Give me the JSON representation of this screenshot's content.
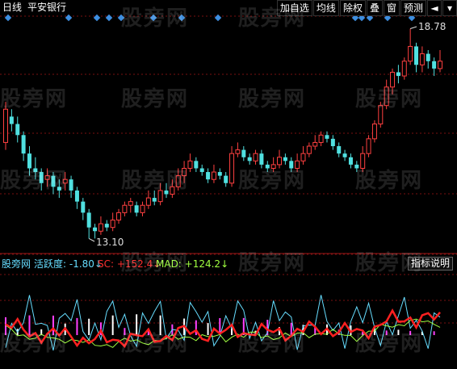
{
  "header": {
    "period": "日线",
    "stock_name": "平安银行"
  },
  "toolbar": {
    "buttons": [
      "加自选",
      "均线",
      "除权",
      "叠",
      "窗",
      "预测"
    ],
    "nav_left_icon": "arrow-left-icon",
    "nav_down_icon": "chevron-down-icon"
  },
  "price_labels": {
    "high": "18.78",
    "low": "13.10"
  },
  "indicator": {
    "name": "股旁网",
    "active_label": "活跃度: -1.80↓",
    "sc_label": "SC: +152.4↓",
    "mad_label": "MAD: +124.2↓",
    "help_button": "指标说明"
  },
  "watermark": "股旁网",
  "colors": {
    "background": "#000000",
    "up": "#ff4040",
    "down": "#50e0e0",
    "grid": "#7a1010",
    "marker": "#3d8ee0",
    "active": "#66ddff",
    "sc": "#ff2020",
    "mad": "#a0ff40",
    "bar_magenta": "#ff40ff"
  },
  "chart_data": {
    "type": "candlestick",
    "high": 18.78,
    "low": 13.1,
    "candles": [
      [
        15.7,
        16.6,
        16.8,
        15.5
      ],
      [
        16.4,
        16.2,
        16.6,
        16.0
      ],
      [
        16.2,
        15.9,
        16.4,
        15.7
      ],
      [
        15.9,
        15.4,
        16.0,
        15.2
      ],
      [
        15.4,
        15.0,
        15.6,
        14.8
      ],
      [
        15.0,
        14.9,
        15.3,
        14.7
      ],
      [
        14.9,
        14.6,
        15.0,
        14.4
      ],
      [
        14.7,
        14.8,
        15.0,
        14.5
      ],
      [
        14.8,
        14.5,
        14.9,
        14.3
      ],
      [
        14.5,
        14.4,
        14.7,
        14.2
      ],
      [
        14.6,
        14.7,
        14.9,
        14.4
      ],
      [
        14.7,
        14.4,
        14.8,
        14.2
      ],
      [
        14.4,
        14.1,
        14.5,
        13.9
      ],
      [
        14.1,
        13.8,
        14.2,
        13.6
      ],
      [
        13.8,
        13.4,
        13.9,
        13.1
      ],
      [
        13.4,
        13.3,
        13.5,
        13.1
      ],
      [
        13.3,
        13.5,
        13.7,
        13.2
      ],
      [
        13.5,
        13.4,
        13.6,
        13.3
      ],
      [
        13.4,
        13.6,
        13.8,
        13.3
      ],
      [
        13.6,
        13.8,
        13.9,
        13.5
      ],
      [
        13.8,
        14.0,
        14.1,
        13.7
      ],
      [
        14.0,
        14.1,
        14.2,
        13.8
      ],
      [
        14.0,
        13.8,
        14.1,
        13.7
      ],
      [
        13.8,
        14.0,
        14.1,
        13.7
      ],
      [
        14.0,
        14.2,
        14.4,
        13.9
      ],
      [
        14.2,
        14.1,
        14.4,
        14.0
      ],
      [
        14.1,
        14.4,
        14.6,
        14.0
      ],
      [
        14.4,
        14.3,
        14.6,
        14.2
      ],
      [
        14.3,
        14.5,
        14.7,
        14.2
      ],
      [
        14.5,
        14.8,
        15.0,
        14.4
      ],
      [
        14.8,
        15.0,
        15.2,
        14.6
      ],
      [
        15.0,
        15.2,
        15.4,
        14.9
      ],
      [
        15.2,
        15.0,
        15.3,
        14.9
      ],
      [
        15.0,
        14.9,
        15.1,
        14.8
      ],
      [
        14.9,
        14.7,
        15.0,
        14.6
      ],
      [
        14.7,
        14.9,
        15.1,
        14.6
      ],
      [
        14.9,
        14.8,
        15.0,
        14.7
      ],
      [
        14.8,
        14.6,
        14.9,
        14.5
      ],
      [
        14.6,
        15.4,
        15.6,
        14.5
      ],
      [
        15.4,
        15.5,
        15.7,
        15.3
      ],
      [
        15.5,
        15.3,
        15.6,
        15.2
      ],
      [
        15.3,
        15.2,
        15.4,
        15.1
      ],
      [
        15.2,
        15.4,
        15.5,
        15.1
      ],
      [
        15.4,
        15.1,
        15.5,
        15.0
      ],
      [
        15.1,
        15.0,
        15.2,
        14.9
      ],
      [
        15.0,
        15.1,
        15.3,
        14.9
      ],
      [
        15.1,
        15.3,
        15.5,
        15.0
      ],
      [
        15.3,
        15.2,
        15.4,
        15.1
      ],
      [
        15.2,
        15.0,
        15.3,
        14.9
      ],
      [
        15.0,
        15.2,
        15.4,
        14.9
      ],
      [
        15.2,
        15.4,
        15.6,
        15.1
      ],
      [
        15.4,
        15.6,
        15.7,
        15.3
      ],
      [
        15.6,
        15.7,
        15.9,
        15.5
      ],
      [
        15.7,
        15.9,
        16.0,
        15.6
      ],
      [
        15.9,
        15.8,
        16.0,
        15.7
      ],
      [
        15.8,
        15.6,
        15.9,
        15.5
      ],
      [
        15.6,
        15.4,
        15.7,
        15.3
      ],
      [
        15.4,
        15.3,
        15.5,
        15.2
      ],
      [
        15.3,
        15.1,
        15.4,
        15.0
      ],
      [
        15.1,
        15.0,
        15.2,
        14.9
      ],
      [
        15.0,
        15.4,
        15.6,
        14.9
      ],
      [
        15.4,
        15.8,
        15.9,
        15.3
      ],
      [
        15.8,
        16.2,
        16.3,
        15.7
      ],
      [
        16.2,
        16.7,
        16.8,
        16.1
      ],
      [
        16.7,
        17.2,
        17.4,
        16.6
      ],
      [
        17.2,
        17.6,
        17.7,
        17.0
      ],
      [
        17.6,
        17.5,
        17.8,
        17.3
      ],
      [
        17.5,
        17.9,
        18.0,
        17.4
      ],
      [
        17.9,
        18.3,
        18.78,
        17.8
      ],
      [
        18.3,
        17.8,
        18.4,
        17.6
      ],
      [
        17.8,
        18.1,
        18.3,
        17.6
      ],
      [
        18.1,
        17.9,
        18.2,
        17.7
      ],
      [
        17.9,
        17.7,
        18.0,
        17.5
      ],
      [
        17.7,
        17.9,
        18.2,
        17.6
      ]
    ]
  }
}
